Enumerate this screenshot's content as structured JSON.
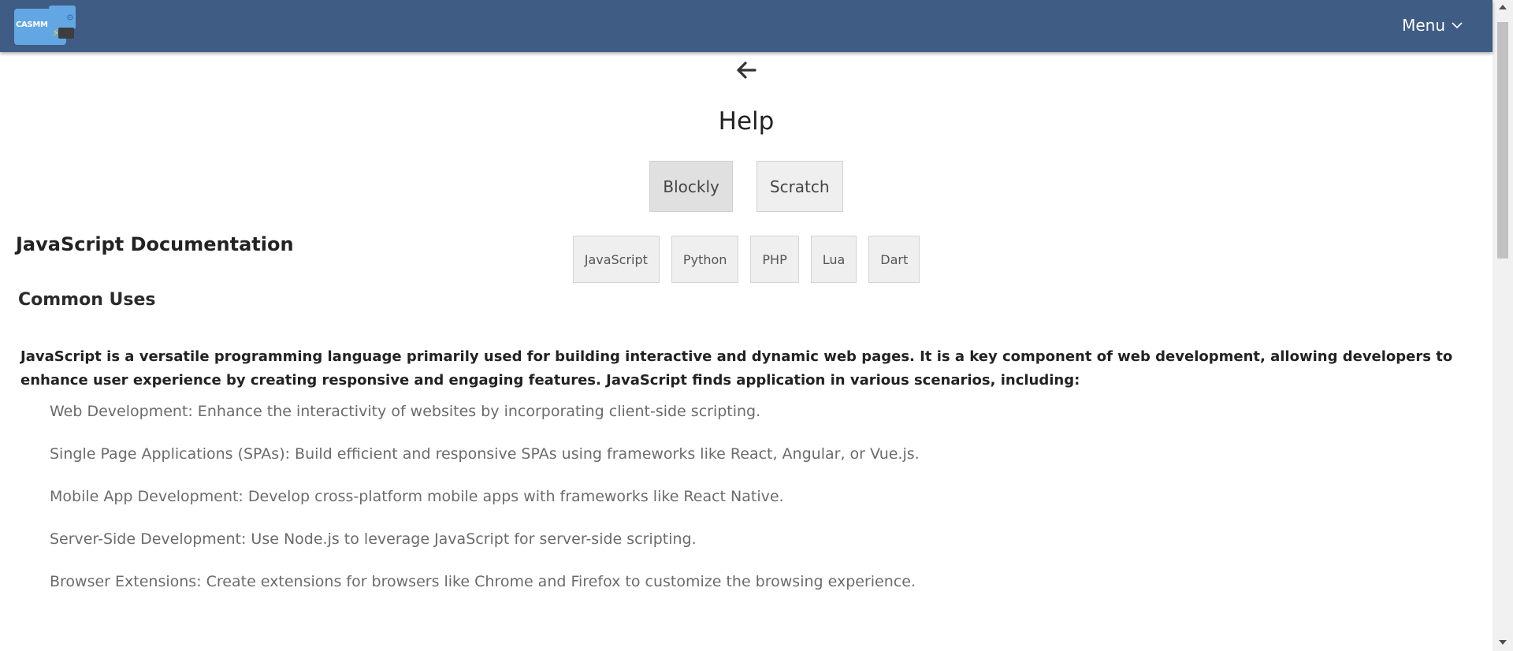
{
  "navbar": {
    "logo_text": "CASMM",
    "menu_label": "Menu"
  },
  "page": {
    "title": "Help"
  },
  "tabs": [
    {
      "label": "Blockly",
      "active": true
    },
    {
      "label": "Scratch",
      "active": false
    }
  ],
  "languages": [
    {
      "label": "JavaScript"
    },
    {
      "label": "Python"
    },
    {
      "label": "PHP"
    },
    {
      "label": "Lua"
    },
    {
      "label": "Dart"
    }
  ],
  "doc": {
    "title": "JavaScript Documentation",
    "section_heading": "Common Uses",
    "intro": "JavaScript is a versatile programming language primarily used for building interactive and dynamic web pages. It is a key component of web development, allowing developers to enhance user experience by creating responsive and engaging features. JavaScript finds application in various scenarios, including:",
    "uses": [
      "Web Development: Enhance the interactivity of websites by incorporating client-side scripting.",
      "Single Page Applications (SPAs): Build efficient and responsive SPAs using frameworks like React, Angular, or Vue.js.",
      "Mobile App Development: Develop cross-platform mobile apps with frameworks like React Native.",
      "Server-Side Development: Use Node.js to leverage JavaScript for server-side scripting.",
      "Browser Extensions: Create extensions for browsers like Chrome and Firefox to customize the browsing experience."
    ]
  },
  "colors": {
    "navbar_bg": "#3f5c84",
    "button_bg": "#efefef",
    "active_button_bg": "#e0e0e0"
  },
  "icons": {
    "back": "arrow-left-icon",
    "menu_caret": "chevron-down-icon"
  }
}
